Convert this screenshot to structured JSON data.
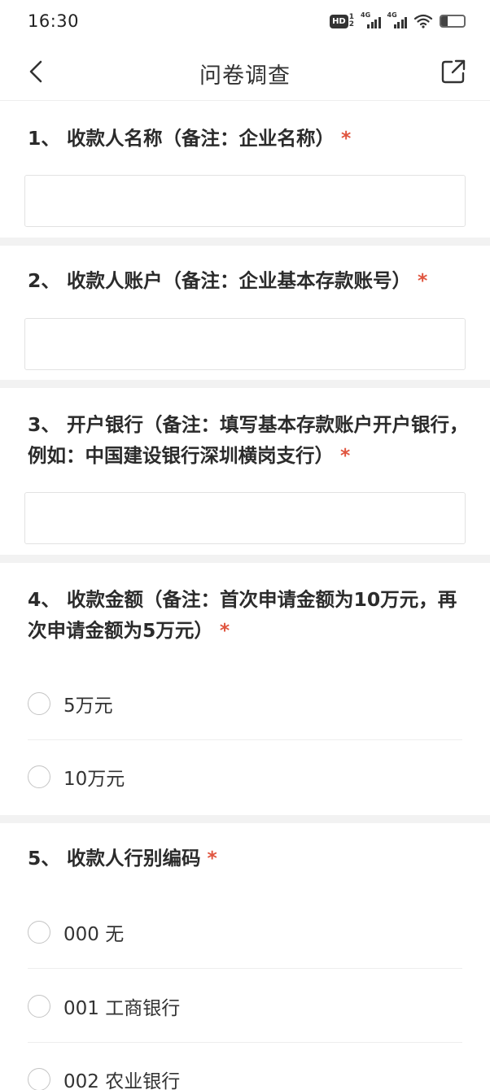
{
  "status_bar": {
    "time": "16:30",
    "hd_label": "HD",
    "hd_sub_top": "1",
    "hd_sub_bottom": "2",
    "signal_1_label": "4G",
    "signal_2_label": "4G",
    "battery_level_percent": 30
  },
  "nav": {
    "title": "问卷调查"
  },
  "questions": [
    {
      "title": "1、 收款人名称（备注：企业名称）",
      "required_mark": "*",
      "input_value": ""
    },
    {
      "title": "2、 收款人账户（备注：企业基本存款账号）",
      "required_mark": "*",
      "input_value": ""
    },
    {
      "title": "3、 开户银行（备注：填写基本存款账户开户银行，例如：中国建设银行深圳横岗支行）",
      "required_mark": "*",
      "input_value": ""
    },
    {
      "title": "4、 收款金额（备注：首次申请金额为10万元，再次申请金额为5万元）",
      "required_mark": "*",
      "options": [
        "5万元",
        "10万元"
      ]
    },
    {
      "title": "5、 收款人行别编码",
      "required_mark": "*",
      "options": [
        "000 无",
        "001 工商银行",
        "002 农业银行"
      ]
    }
  ],
  "colors": {
    "required": "#e0553f",
    "separator": "#f2f2f2",
    "text": "#2b2b2b"
  }
}
